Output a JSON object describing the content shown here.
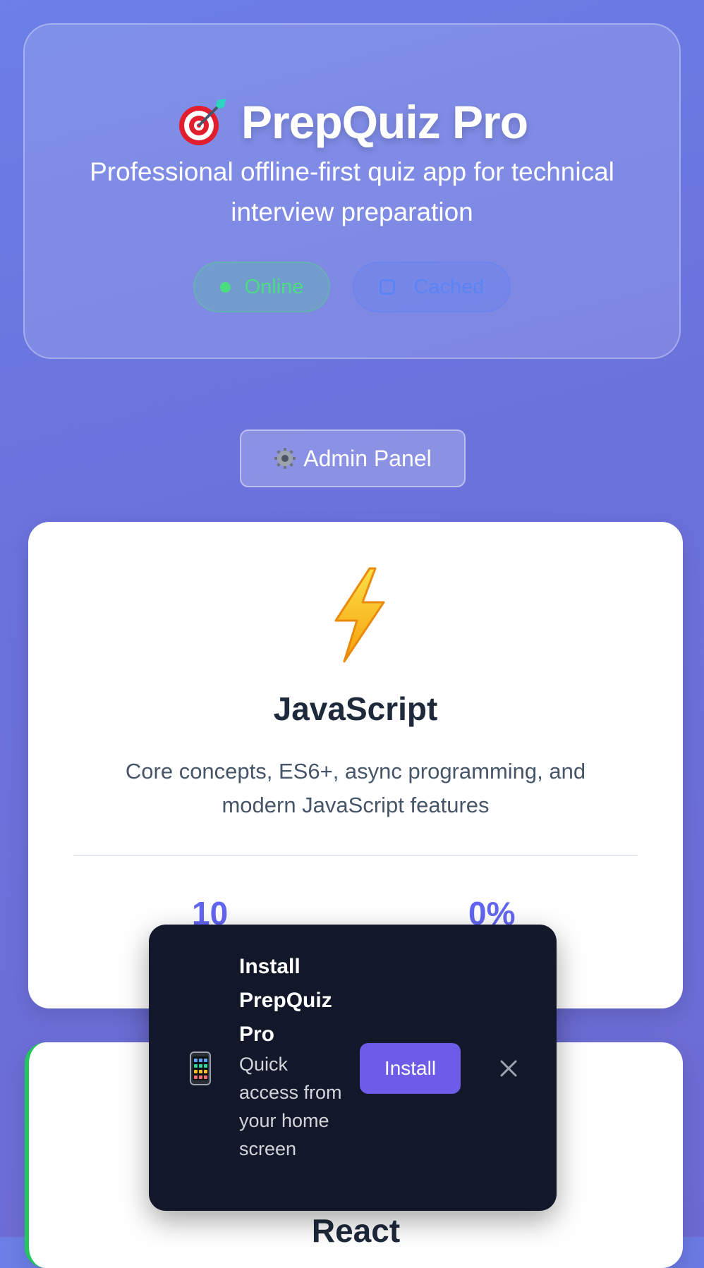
{
  "header": {
    "title": "PrepQuiz Pro",
    "title_icon": "target-dart-icon",
    "subtitle": "Professional offline-first quiz app for technical interview preparation",
    "status": {
      "online_label": "Online",
      "cached_label": "Cached"
    }
  },
  "admin": {
    "label": "Admin Panel",
    "icon": "gear-icon"
  },
  "quizzes": [
    {
      "icon": "lightning-icon",
      "title": "JavaScript",
      "description": "Core concepts, ES6+, async programming, and modern JavaScript features",
      "questions": "10",
      "progress": "0%",
      "accent": "#6366f1"
    },
    {
      "title": "React",
      "accent": "#22c55e"
    }
  ],
  "install_prompt": {
    "icon": "mobile-phone-icon",
    "title": "Install PrepQuiz Pro",
    "subtitle": "Quick access from your home screen",
    "install_label": "Install",
    "close_icon": "close-icon"
  },
  "colors": {
    "online": "#4ade80",
    "cached": "#5b84f3",
    "install_button": "#6c5ce7",
    "toast_background": "#121829"
  }
}
